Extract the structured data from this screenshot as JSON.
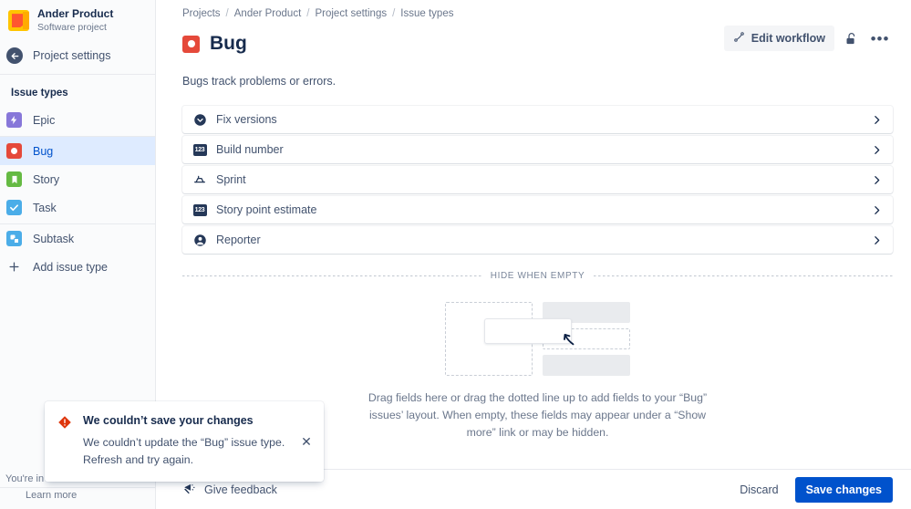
{
  "sidebar": {
    "project": {
      "name": "Ander Product",
      "type": "Software project",
      "avatar_icon": "project-avatar"
    },
    "back": {
      "label": "Project settings",
      "icon": "back-arrow-icon"
    },
    "section_title": "Issue types",
    "items": [
      {
        "label": "Epic",
        "icon": "epic-icon",
        "selected": false
      },
      {
        "label": "Bug",
        "icon": "bug-icon",
        "selected": true
      },
      {
        "label": "Story",
        "icon": "story-icon",
        "selected": false
      },
      {
        "label": "Task",
        "icon": "task-icon",
        "selected": false
      },
      {
        "label": "Subtask",
        "icon": "subtask-icon",
        "selected": false
      }
    ],
    "add_issue_type": {
      "label": "Add issue type",
      "icon": "plus-icon"
    },
    "footer": {
      "youre_in": "You're in",
      "learn_more": "Learn more"
    }
  },
  "breadcrumb": [
    {
      "label": "Projects"
    },
    {
      "label": "Ander Product"
    },
    {
      "label": "Project settings"
    },
    {
      "label": "Issue types"
    }
  ],
  "breadcrumb_separator": "/",
  "header": {
    "title": "Bug",
    "title_icon": "bug-icon",
    "subtitle": "Bugs track problems or errors.",
    "edit_workflow_label": "Edit workflow",
    "edit_workflow_icon": "workflow-icon",
    "lock_icon": "unlocked-padlock-icon",
    "more_icon": "more-actions-icon",
    "more_label": "•••"
  },
  "fields": [
    {
      "label": "Fix versions",
      "icon": "chevron-down-circle-icon",
      "chevron": "chevron-right-icon"
    },
    {
      "label": "Build number",
      "icon": "number-field-icon",
      "chevron": "chevron-right-icon",
      "badge": "123"
    },
    {
      "label": "Sprint",
      "icon": "sprint-icon",
      "chevron": "chevron-right-icon"
    },
    {
      "label": "Story point estimate",
      "icon": "number-field-icon",
      "chevron": "chevron-right-icon",
      "badge": "123"
    },
    {
      "label": "Reporter",
      "icon": "person-icon",
      "chevron": "chevron-right-icon"
    }
  ],
  "hide_when_empty": {
    "label": "HIDE WHEN EMPTY",
    "empty_text": "Drag fields here or drag the dotted line up to add fields to your “Bug” issues’ layout. When empty, these fields may appear under a “Show more” link or may be hidden."
  },
  "bottom_bar": {
    "feedback_label": "Give feedback",
    "feedback_icon": "megaphone-icon",
    "discard_label": "Discard",
    "save_label": "Save changes"
  },
  "flag": {
    "title": "We couldn’t save your changes",
    "description": "We couldn’t update the “Bug” issue type. Refresh and try again.",
    "icon": "error-icon",
    "close_label": "✕"
  },
  "colors": {
    "primary": "#0052cc",
    "selected_bg": "#deebff",
    "error": "#de350b",
    "epic": "#8777d9",
    "bug": "#e5493a",
    "story": "#65ba43",
    "task": "#4bade8",
    "text": "#172b4d",
    "muted": "#6b778c"
  }
}
